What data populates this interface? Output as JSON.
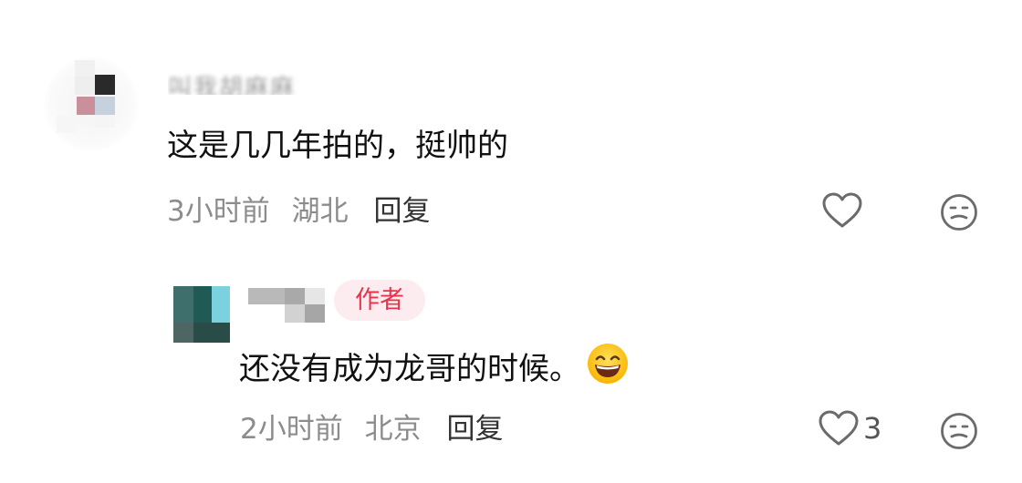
{
  "comments": [
    {
      "username": "叫我胡麻麻",
      "text": "这是几几年拍的，挺帅的",
      "time": "3小时前",
      "location": "湖北",
      "reply_label": "回复",
      "likes": "",
      "replies": [
        {
          "username": "",
          "badge": "作者",
          "text": "还没有成为龙哥的时候。",
          "emoji": "grinning-face",
          "time": "2小时前",
          "location": "北京",
          "reply_label": "回复",
          "likes": "3"
        }
      ]
    }
  ],
  "icons": {
    "like": "heart-outline-icon",
    "dislike": "meh-face-icon",
    "emoji": "grinning-face-emoji"
  },
  "colors": {
    "author_badge_bg": "#fdecef",
    "author_badge_text": "#e8334c",
    "meta_text": "#8c8c8c",
    "body_text": "#111111"
  }
}
